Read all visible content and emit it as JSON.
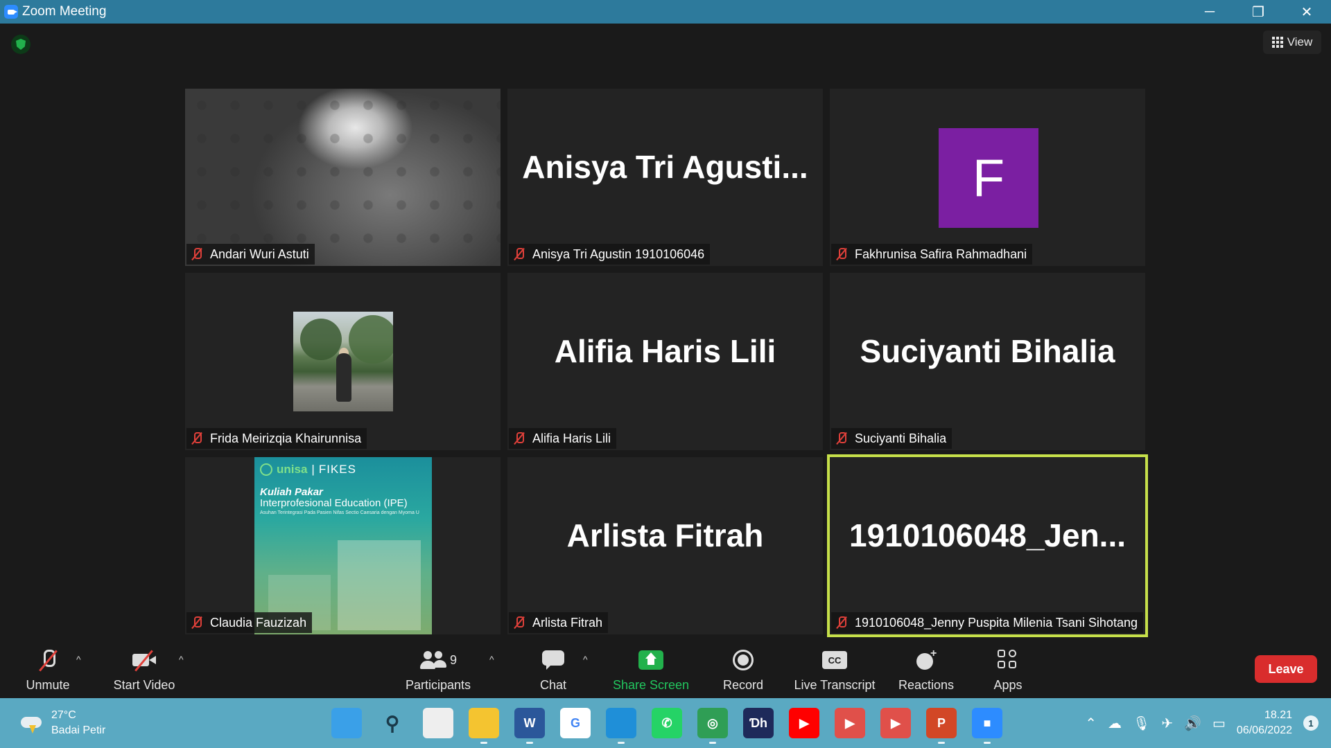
{
  "window": {
    "title": "Zoom Meeting",
    "minimize_glyph": "─",
    "restore_glyph": "❐",
    "close_glyph": "✕"
  },
  "top": {
    "view_label": "View",
    "security_icon": "shield-check-icon"
  },
  "tiles": [
    {
      "display_name": "",
      "label": "Andari Wuri Astuti",
      "kind": "video"
    },
    {
      "display_name": "Anisya Tri Agusti...",
      "label": "Anisya Tri Agustin 1910106046",
      "kind": "name"
    },
    {
      "display_name": "F",
      "label": "Fakhrunisa Safira Rahmadhani",
      "kind": "avatar",
      "avatar_color": "#7b1fa2"
    },
    {
      "display_name": "",
      "label": "Frida Meirizqia Khairunnisa",
      "kind": "photo"
    },
    {
      "display_name": "Alifia Haris Lili",
      "label": "Alifia Haris Lili",
      "kind": "name"
    },
    {
      "display_name": "Suciyanti Bihalia",
      "label": "Suciyanti Bihalia",
      "kind": "name"
    },
    {
      "display_name": "",
      "label": "Claudia Fauzizah",
      "kind": "slide"
    },
    {
      "display_name": "Arlista Fitrah",
      "label": "Arlista Fitrah",
      "kind": "name"
    },
    {
      "display_name": "1910106048_Jen...",
      "label": "1910106048_Jenny Puspita Milenia Tsani Sihotang",
      "kind": "name",
      "active_speaker": true
    }
  ],
  "slide": {
    "logo": "unisa",
    "faculty": "FIKES",
    "title_line1": "Kuliah Pakar",
    "title_line2": "Interprofesional Education (IPE)",
    "subtitle": "Asuhan Terintegrasi Pada Pasien Nifas Sectio Caesaria dengan Myoma U"
  },
  "toolbar": {
    "unmute": "Unmute",
    "start_video": "Start Video",
    "participants": "Participants",
    "participant_count": "9",
    "chat": "Chat",
    "share_screen": "Share Screen",
    "record": "Record",
    "live_transcript": "Live Transcript",
    "cc_text": "CC",
    "reactions": "Reactions",
    "apps": "Apps",
    "leave": "Leave",
    "caret": "^"
  },
  "taskbar": {
    "weather_temp": "27°C",
    "weather_desc": "Badai Petir",
    "time": "18.21",
    "date": "06/06/2022",
    "notification_count": "1",
    "apps": [
      {
        "name": "start",
        "glyph": "",
        "color": "#3aa0e8"
      },
      {
        "name": "search",
        "glyph": "⚲",
        "color": "transparent"
      },
      {
        "name": "task-view",
        "glyph": "",
        "color": "#eeeeee"
      },
      {
        "name": "file-explorer",
        "glyph": "",
        "color": "#f4c430"
      },
      {
        "name": "word",
        "glyph": "W",
        "color": "#2b579a"
      },
      {
        "name": "google",
        "glyph": "G",
        "color": "#ffffff"
      },
      {
        "name": "edge",
        "glyph": "",
        "color": "#1f8fd8"
      },
      {
        "name": "whatsapp",
        "glyph": "✆",
        "color": "#25d366"
      },
      {
        "name": "app-green",
        "glyph": "◎",
        "color": "#2f9e55"
      },
      {
        "name": "dh",
        "glyph": "Ɗh",
        "color": "#1e2a5a"
      },
      {
        "name": "youtube",
        "glyph": "▶",
        "color": "#ff0000"
      },
      {
        "name": "player-1",
        "glyph": "▶",
        "color": "#e0504a"
      },
      {
        "name": "player-2",
        "glyph": "▶",
        "color": "#e0504a"
      },
      {
        "name": "powerpoint",
        "glyph": "P",
        "color": "#d24726"
      },
      {
        "name": "zoom",
        "glyph": "■",
        "color": "#2d8cff"
      }
    ]
  },
  "colors": {
    "titlebar": "#2d7a9c",
    "active_speaker_border": "#c6e04a",
    "muted_red": "#e0403a",
    "share_green": "#22b14c",
    "leave_red": "#d92d2d",
    "taskbar": "#5aa9c2"
  }
}
